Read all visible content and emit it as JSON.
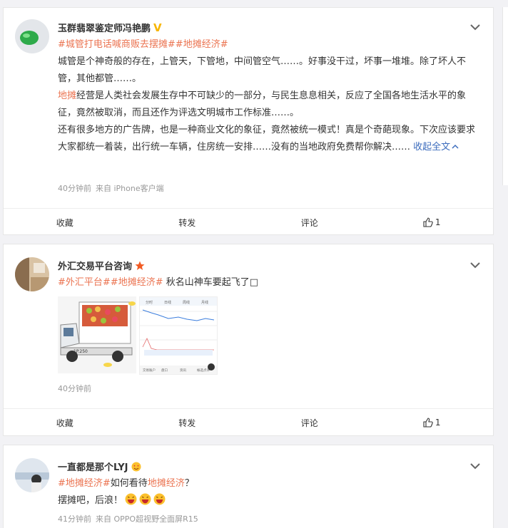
{
  "posts": [
    {
      "username": "玉群翡翠鉴定师冯艳鹏",
      "badge": "V",
      "tag1": "#城管打电话喊商贩去摆摊#",
      "tag2": "#地摊经济#",
      "p1": "城管是个神奇般的存在，上管天，下管地，中间管空气……。好事没干过，坏事一堆堆。除了坏人不管，其他都管……。",
      "p2_hl": "地摊",
      "p2": "经营是人类社会发展生存中不可缺少的一部分，与民生息息相关，反应了全国各地生活水平的象征，竟然被取消，而且还作为评选文明城市工作标准……。",
      "p3": "还有很多地方的广告牌，也是一种商业文化的象征，竟然被统一模式！真是个奇葩现象。下次应该要求大家都统一着装，出行统一车辆，住房统一安排……没有的当地政府免费帮你解决……",
      "collapse": "收起全文",
      "time": "40分钟前",
      "source": "来自 iPhone客户端",
      "fav": "收藏",
      "repost": "转发",
      "comment": "评论",
      "likes": "1"
    },
    {
      "username": "外汇交易平台咨询",
      "tag1": "#外汇平台#",
      "tag2": "#地摊经济#",
      "text": " 秋名山神车要起飞了",
      "box": "□",
      "truck_plate": "1P.250",
      "chart_tabs": [
        "分时",
        "日线",
        "周线",
        "月线"
      ],
      "chart_btns": [
        "交易账户",
        "盘口",
        "资讯",
        "帐选点评"
      ],
      "time": "40分钟前",
      "fav": "收藏",
      "repost": "转发",
      "comment": "评论",
      "likes": "1"
    },
    {
      "username": "一直都是那个LYJ",
      "tag1": "#地摊经济#",
      "text_mid": "如何看待",
      "hl": "地摊经济",
      "q": "？",
      "line2": "摆摊吧，后浪！",
      "time": "41分钟前",
      "source": "来自 OPPO超视野全面屏R15"
    }
  ],
  "colors": {
    "tag": "#eb7350",
    "link": "#3c6cbd",
    "bg": "#f2f2f5"
  }
}
